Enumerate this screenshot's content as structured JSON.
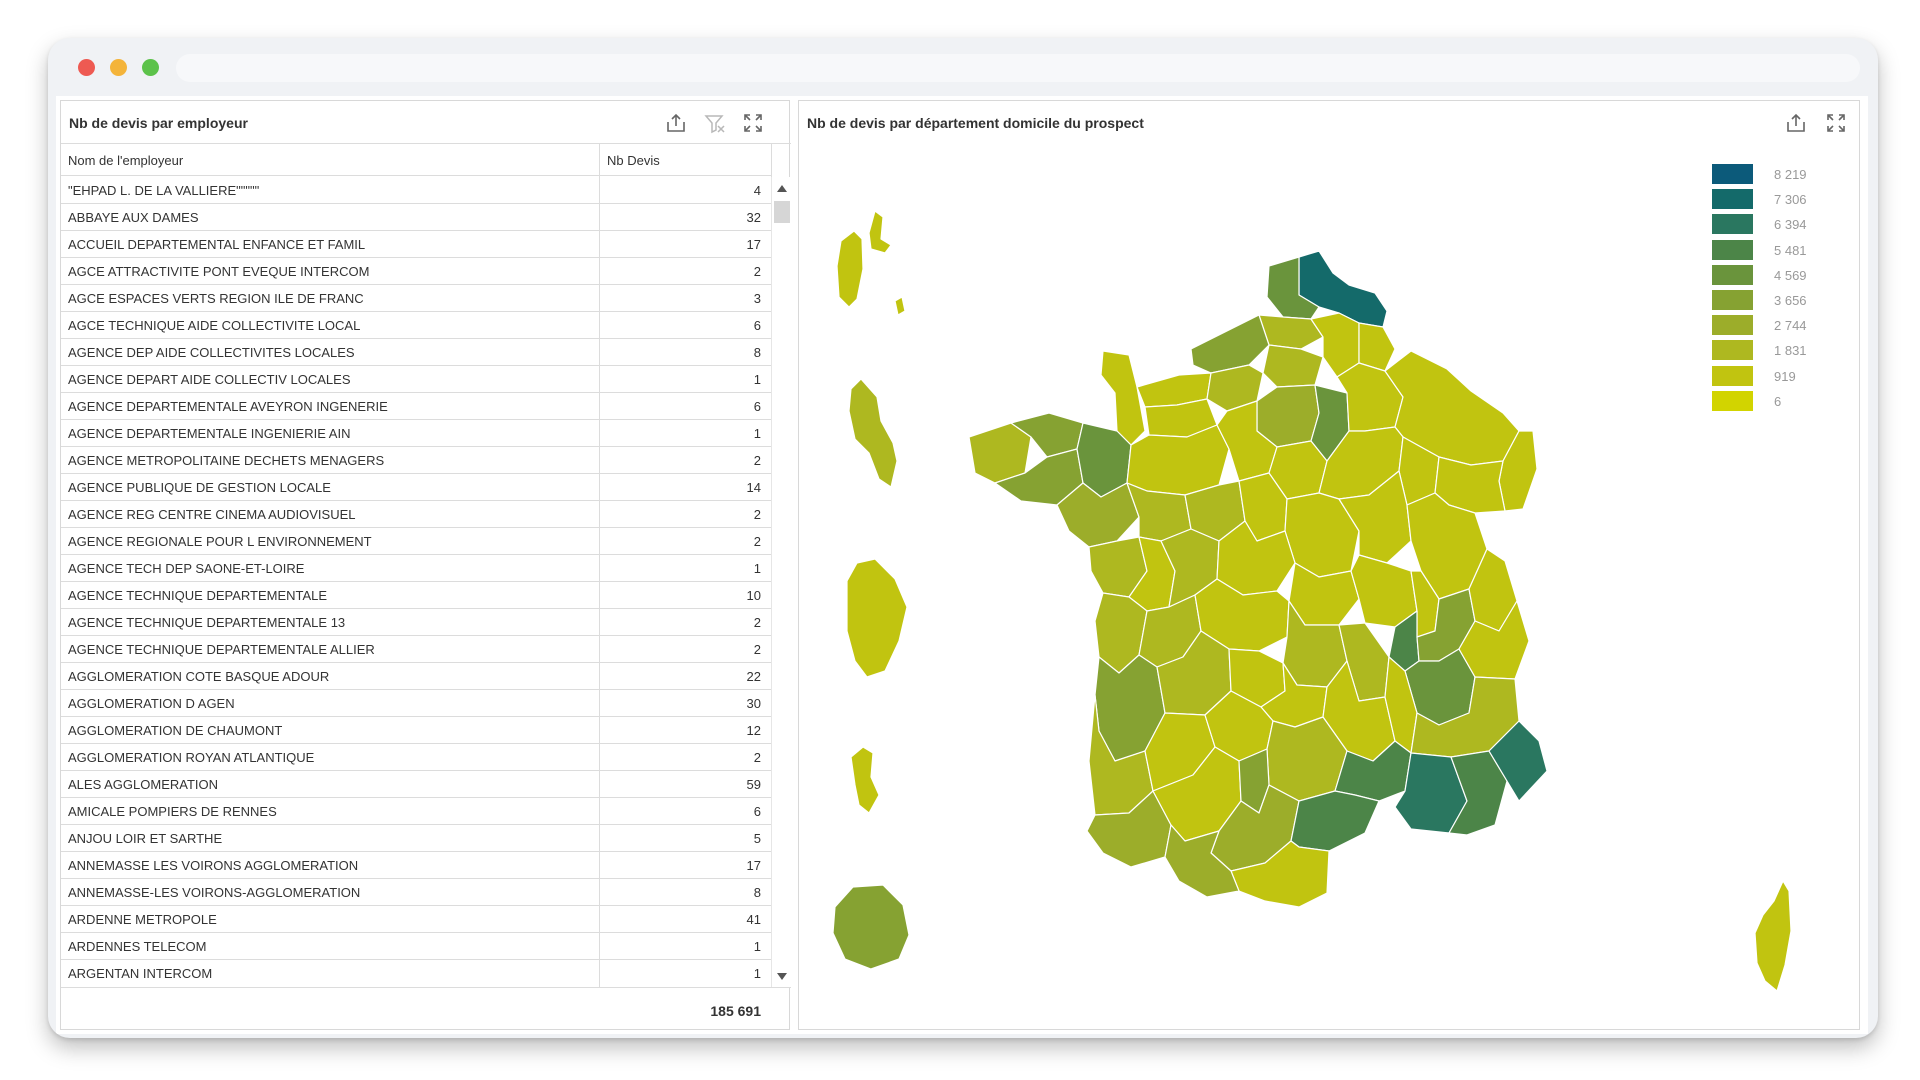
{
  "left_panel": {
    "title": "Nb de devis par employeur",
    "col_name": "Nom de l'employeur",
    "col_value": "Nb Devis",
    "rows": [
      {
        "name": "\"EHPAD L. DE LA VALLIERE\"\"\"\"\"",
        "value": "4"
      },
      {
        "name": "ABBAYE AUX DAMES",
        "value": "32"
      },
      {
        "name": "ACCUEIL DEPARTEMENTAL ENFANCE ET FAMIL",
        "value": "17"
      },
      {
        "name": "AGCE ATTRACTIVITE PONT EVEQUE INTERCOM",
        "value": "2"
      },
      {
        "name": "AGCE ESPACES VERTS REGION ILE DE FRANC",
        "value": "3"
      },
      {
        "name": "AGCE TECHNIQUE AIDE COLLECTIVITE LOCAL",
        "value": "6"
      },
      {
        "name": "AGENCE DEP AIDE COLLECTIVITES LOCALES",
        "value": "8"
      },
      {
        "name": "AGENCE DEPART AIDE COLLECTIV LOCALES",
        "value": "1"
      },
      {
        "name": "AGENCE DEPARTEMENTALE AVEYRON INGENERIE",
        "value": "6"
      },
      {
        "name": "AGENCE DEPARTEMENTALE INGENIERIE AIN",
        "value": "1"
      },
      {
        "name": "AGENCE METROPOLITAINE DECHETS MENAGERS",
        "value": "2"
      },
      {
        "name": "AGENCE PUBLIQUE DE GESTION LOCALE",
        "value": "14"
      },
      {
        "name": "AGENCE REG CENTRE CINEMA AUDIOVISUEL",
        "value": "2"
      },
      {
        "name": "AGENCE REGIONALE POUR L ENVIRONNEMENT",
        "value": "2"
      },
      {
        "name": "AGENCE TECH DEP SAONE-ET-LOIRE",
        "value": "1"
      },
      {
        "name": "AGENCE TECHNIQUE DEPARTEMENTALE",
        "value": "10"
      },
      {
        "name": "AGENCE TECHNIQUE DEPARTEMENTALE 13",
        "value": "2"
      },
      {
        "name": "AGENCE TECHNIQUE DEPARTEMENTALE ALLIER",
        "value": "2"
      },
      {
        "name": "AGGLOMERATION COTE BASQUE ADOUR",
        "value": "22"
      },
      {
        "name": "AGGLOMERATION D AGEN",
        "value": "30"
      },
      {
        "name": "AGGLOMERATION DE CHAUMONT",
        "value": "12"
      },
      {
        "name": "AGGLOMERATION ROYAN ATLANTIQUE",
        "value": "2"
      },
      {
        "name": "ALES AGGLOMERATION",
        "value": "59"
      },
      {
        "name": "AMICALE POMPIERS DE RENNES",
        "value": "6"
      },
      {
        "name": "ANJOU LOIR ET SARTHE",
        "value": "5"
      },
      {
        "name": "ANNEMASSE LES VOIRONS AGGLOMERATION",
        "value": "17"
      },
      {
        "name": "ANNEMASSE-LES VOIRONS-AGGLOMERATION",
        "value": "8"
      },
      {
        "name": "ARDENNE METROPOLE",
        "value": "41"
      },
      {
        "name": "ARDENNES TELECOM",
        "value": "1"
      },
      {
        "name": "ARGENTAN INTERCOM",
        "value": "1"
      }
    ],
    "total": "185 691",
    "icons": [
      "export-icon",
      "clear-filter-icon",
      "fullscreen-icon"
    ]
  },
  "right_panel": {
    "title": "Nb de devis par département domicile du prospect",
    "icons": [
      "export-icon",
      "fullscreen-icon"
    ],
    "legend": [
      {
        "label": "8 219",
        "color": "#0c5a7a"
      },
      {
        "label": "7 306",
        "color": "#146a6a"
      },
      {
        "label": "6 394",
        "color": "#2a7760"
      },
      {
        "label": "5 481",
        "color": "#4c8548"
      },
      {
        "label": "4 569",
        "color": "#6a943c"
      },
      {
        "label": "3 656",
        "color": "#86a232"
      },
      {
        "label": "2 744",
        "color": "#9cad2a"
      },
      {
        "label": "1 831",
        "color": "#aeb820"
      },
      {
        "label": "919",
        "color": "#c1c410"
      },
      {
        "label": "6",
        "color": "#d2d400"
      }
    ]
  }
}
